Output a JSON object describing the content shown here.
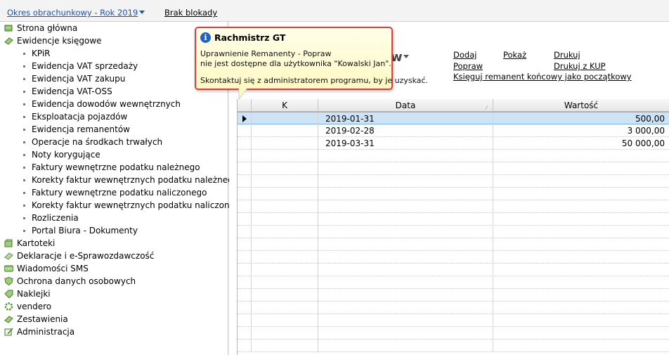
{
  "topbar": {
    "period_label": "Okres obrachunkowy - Rok 2019",
    "lock_label": "Brak blokady"
  },
  "sidebar": {
    "items": [
      {
        "label": "Strona główna",
        "icon": "home-icon"
      },
      {
        "label": "Ewidencje księgowe",
        "icon": "books-icon"
      },
      {
        "label": "Kartoteki",
        "icon": "cards-icon"
      },
      {
        "label": "Deklaracje i e-Sprawozdawczość",
        "icon": "declaration-icon"
      },
      {
        "label": "Wiadomości SMS",
        "icon": "sms-icon"
      },
      {
        "label": "Ochrona danych osobowych",
        "icon": "shield-icon"
      },
      {
        "label": "Naklejki",
        "icon": "labels-icon"
      },
      {
        "label": "vendero",
        "icon": "vendero-icon"
      },
      {
        "label": "Zestawienia",
        "icon": "reports-icon"
      },
      {
        "label": "Administracja",
        "icon": "admin-icon"
      }
    ],
    "subitems": [
      "KPiR",
      "Ewidencja VAT sprzedaży",
      "Ewidencja VAT zakupu",
      "Ewidencja VAT-OSS",
      "Ewidencja dowodów wewnętrznych",
      "Eksploatacja pojazdów",
      "Ewidencja remanentów",
      "Operacje na środkach trwałych",
      "Noty korygujące",
      "Faktury wewnętrzne podatku należnego",
      "Korekty faktur wewnętrznych podatku należnego",
      "Faktury wewnętrzne podatku naliczonego",
      "Korekty faktur wewnętrznych podatku naliczonego",
      "Rozliczenia",
      "Portal Biura - Dokumenty"
    ]
  },
  "main": {
    "title_fragment": "w",
    "actions": {
      "add": "Dodaj",
      "show": "Pokaż",
      "print": "Drukuj",
      "edit": "Popraw",
      "print_kup": "Drukuj z KUP",
      "post_remnant": "Księguj remanent końcowy jako początkowy"
    },
    "grid": {
      "columns": [
        "K",
        "Data",
        "Wartość"
      ],
      "rows": [
        {
          "k": "",
          "date": "2019-01-31",
          "value": "500,00",
          "selected": true
        },
        {
          "k": "",
          "date": "2019-02-28",
          "value": "3 000,00",
          "selected": false
        },
        {
          "k": "",
          "date": "2019-03-31",
          "value": "50 000,00",
          "selected": false
        }
      ]
    }
  },
  "tooltip": {
    "title": "Rachmistrz GT",
    "line1": "Uprawnienie Remanenty - Popraw",
    "line2": "nie jest dostępne dla użytkownika \"Kowalski Jan\".",
    "line3": "Skontaktuj się z administratorem programu, by je uzyskać.",
    "icon": "info-icon",
    "border_color": "#e23b3b"
  }
}
